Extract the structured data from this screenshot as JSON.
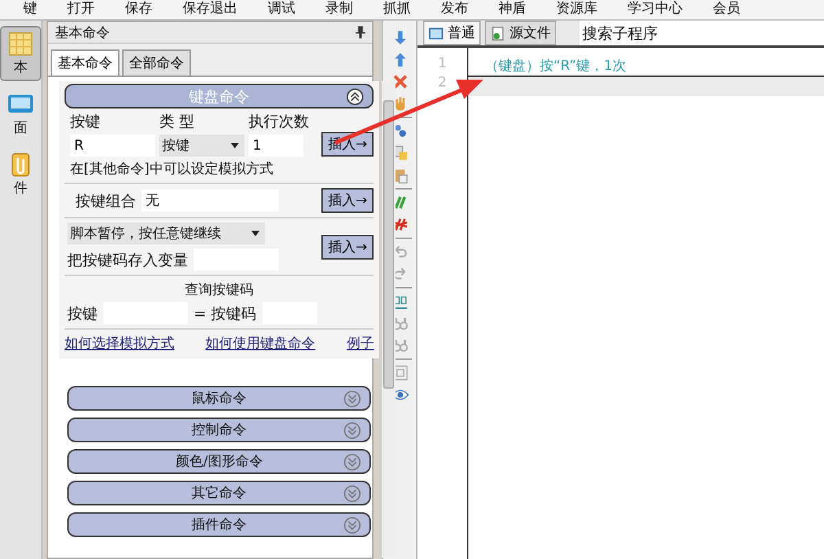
{
  "menu_bar": [
    "键",
    "打开",
    "保存",
    "保存退出",
    "调试",
    "录制",
    "抓抓",
    "发布",
    "神盾",
    "资源库",
    "学习中心",
    "会员"
  ],
  "sidebar": [
    {
      "label": "本",
      "selected": true
    },
    {
      "label": "面",
      "selected": false
    },
    {
      "label": "件",
      "selected": false
    }
  ],
  "panel": {
    "title": "基本命令",
    "tabs": [
      {
        "label": "基本命令",
        "selected": true
      },
      {
        "label": "全部命令",
        "selected": false
      }
    ],
    "keyboard": {
      "header": "键盘命令",
      "expanded": true,
      "key_label": "按键",
      "type_label": "类 型",
      "count_label": "执行次数",
      "key_value": "R",
      "type_value": "按键",
      "count_value": "1",
      "insert_button": "插入→",
      "note": "在[其他命令]中可以设定模拟方式",
      "combo_label": "按键组合",
      "combo_value": "无",
      "combo_insert_button": "插入→",
      "pause_value": "脚本暂停，按任意键继续",
      "store_label": "把按键码存入变量",
      "pause_insert_button": "插入→",
      "query_title": "查询按键码",
      "query_key_label": "按键",
      "query_code_label": "= 按键码",
      "links": [
        "如何选择模拟方式",
        "如何使用键盘命令",
        "例子"
      ]
    },
    "sections": [
      {
        "label": "鼠标命令",
        "expanded": false
      },
      {
        "label": "控制命令",
        "expanded": false
      },
      {
        "label": "颜色/图形命令",
        "expanded": false
      },
      {
        "label": "其它命令",
        "expanded": false
      },
      {
        "label": "插件命令",
        "expanded": false
      }
    ]
  },
  "editor": {
    "tabs": [
      {
        "label": "普通",
        "selected": true
      },
      {
        "label": "源文件",
        "selected": false
      }
    ],
    "search": {
      "placeholder": "搜索子程序"
    },
    "lines": [
      {
        "number": "1",
        "text": "（键盘）按“R”键，1次",
        "selected": false
      },
      {
        "number": "2",
        "selected": true
      }
    ]
  }
}
